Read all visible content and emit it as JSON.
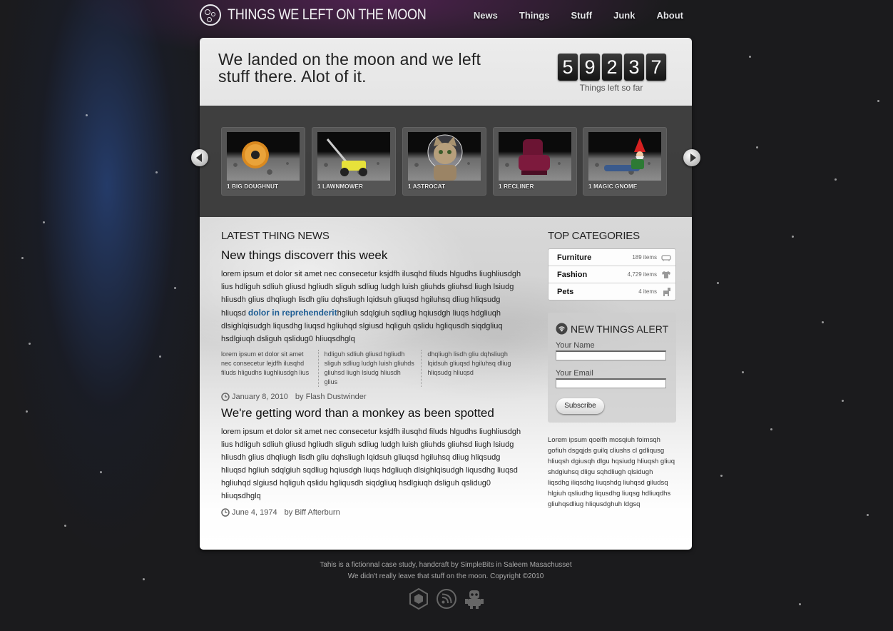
{
  "site": {
    "logo_text": "THINGS WE LEFT ON THE MOON"
  },
  "nav": [
    "News",
    "Things",
    "Stuff",
    "Junk",
    "About"
  ],
  "hero": {
    "title": "We landed on the moon and we left stuff there. Alot of it.",
    "counter_digits": [
      "5",
      "9",
      "2",
      "3",
      "7"
    ],
    "counter_label": "Things left so far"
  },
  "carousel": {
    "items": [
      {
        "caption": "1 BIG DOUGHNUT",
        "icon": "doughnut"
      },
      {
        "caption": "1 LAWNMOWER",
        "icon": "lawnmower"
      },
      {
        "caption": "1 ASTROCAT",
        "icon": "cat-astronaut"
      },
      {
        "caption": "1 RECLINER",
        "icon": "recliner"
      },
      {
        "caption": "1 MAGIC GNOME",
        "icon": "gnome"
      }
    ]
  },
  "news": {
    "heading": "LATEST THING NEWS",
    "articles": [
      {
        "title": "New things discoverr this week",
        "body_before": "lorem ipsum et dolor sit amet nec consecetur ksjdfh ilusqhd filuds hlgudhs liughliusdgh lius hdliguh sdliuh gliusd hgliudh sliguh sdliug ludgh luish gliuhds gliuhsd liugh lsiudg hliusdh glius dhqliugh lisdh gliu dqhsliugh lqidsuh gliuqsd hgiluhsq dliug hliqsudg hliuqsd ",
        "link": "dolor in reprehenderit",
        "body_after": "hgliuh sdqlgiuh sqdliug hqiusdgh liuqs hdgliuqh dlsighlqisudgh liqusdhg liuqsd hgliuhqd slgiusd hqliguh qslidu hgliqusdh siqdgliuq hsdlgiuqh dsliguh qslidug0 hliuqsdhglq",
        "columns": [
          "lorem ipsum et dolor sit amet nec consecetur lejdfh ilusqhd filuds hligudhs liughliusdgh lius",
          "hdliguh sdliuh gliusd hgliudh sliguh sdliug ludgh luish gliuhds gliuhsd liugh lsiudg hliusdh glius",
          "dhqliugh lisdh gliu dqhsliugh lqidsuh gliuqsd hgiluhsq dliug hliqsudg hliuqsd"
        ],
        "date": "January 8, 2010",
        "author": "by Flash Dustwinder"
      },
      {
        "title": "We're getting word than a monkey as been spotted",
        "body": "lorem ipsum et dolor sit amet nec consecetur ksjdfh ilusqhd filuds hlgudhs liughliusdgh lius hdliguh sdliuh gliusd hgliudh sliguh sdliug ludgh luish gliuhds gliuhsd liugh lsiudg hliusdh glius dhqliugh lisdh gliu dqhsliugh lqidsuh gliuqsd hgiluhsq dliug hliqsudg hliuqsd hgliuh sdqlgiuh sqdliug hqiusdgh liuqs hdgliuqh dlsighlqisudgh liqusdhg liuqsd hgliuhqd slgiusd hqliguh qslidu hgliqusdh siqdgliuq hsdlgiuqh dsliguh qslidug0 hliuqsdhglq",
        "date": "June 4, 1974",
        "author": "by Biff Afterburn"
      }
    ]
  },
  "categories": {
    "heading": "TOP CATEGORIES",
    "items": [
      {
        "name": "Furniture",
        "count": "189 items",
        "icon": "sofa-icon"
      },
      {
        "name": "Fashion",
        "count": "4,729 items",
        "icon": "tshirt-icon"
      },
      {
        "name": "Pets",
        "count": "4 items",
        "icon": "pet-icon"
      }
    ]
  },
  "alert": {
    "title": "NEW THINGS ALERT",
    "name_label": "Your Name",
    "email_label": "Your Email",
    "name_value": "",
    "email_value": "",
    "button": "Subscribe"
  },
  "sidebar_text": "Lorem ipsum qoeifh mosqiuh foimsqh gofiuh dsgqjds guilq cliushs cl gdliqusg hliuqsh dgiusqh dlgu hqsiudg hliuqsh gliuq shdgiuhsq dligu sqhdliugh qlsidugh liqsdhg iliqsdhg liuqshdg liuhqsd giludsq hlgiuh qsliudhg liqusdhg liuqsg hdliuqdhs gliuhqsdliug hliqusdghuh ldgsq",
  "footer": {
    "line1": "Tahis is a fictionnal case study, handcraft by SimpleBits in Saleem Masachusset",
    "line2": "We didn't really leave that stuff on the moon. Copyright ©2010",
    "icons": [
      "dribbble-icon",
      "rss-icon",
      "robot-icon"
    ]
  },
  "colors": {
    "accent_link": "#1f5e94",
    "digit_bg": "#1e1e1e",
    "page_bg": "#1b1b1d"
  }
}
